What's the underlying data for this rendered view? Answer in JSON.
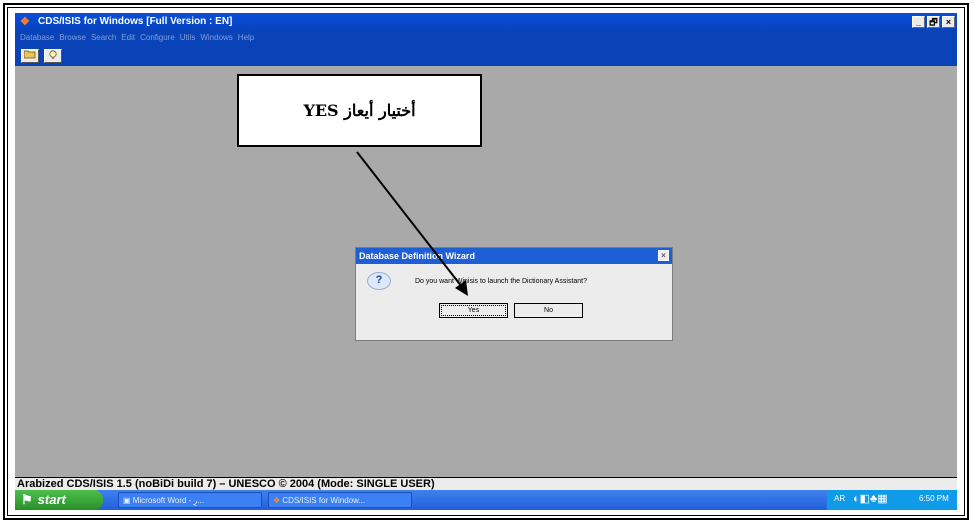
{
  "window": {
    "title": "CDS/ISIS for Windows [Full Version : EN]",
    "controls": [
      "_",
      "🗗",
      "×"
    ]
  },
  "menu": [
    "Database",
    "Browse",
    "Search",
    "Edit",
    "Configure",
    "Utils",
    "Windows",
    "Help"
  ],
  "toolbar": {
    "icons": [
      "folder-open-icon",
      "lightbulb-icon"
    ]
  },
  "dialog": {
    "title": "Database Definition Wizard",
    "message": "Do you want Winisis to launch the Dictionary Assistant?",
    "yes_label": "Yes",
    "no_label": "No",
    "close_glyph": "×"
  },
  "annotation": {
    "text": "أختيار أيعاز YES"
  },
  "statusbar": {
    "text": "Arabized CDS/ISIS 1.5 (noBiDi build 7) – UNESCO © 2004 (Mode: SINGLE USER)"
  },
  "taskbar": {
    "start_label": "start",
    "items": [
      "Microsoft Word - رِ...",
      "CDS/ISIS for Window..."
    ],
    "tray_lang": "AR",
    "clock": "6:50 PM"
  }
}
